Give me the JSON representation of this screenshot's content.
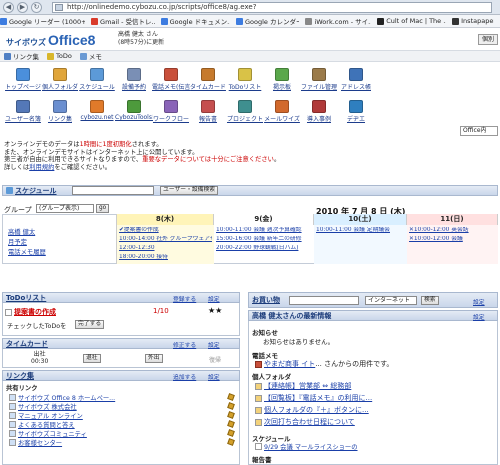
{
  "browser": {
    "url": "http://onlinedemo.cybozu.co.jp/scripts/office8/ag.exe?",
    "bookmarks": [
      {
        "label": "Google リーダー (1000+)",
        "color": "#3d7ce0"
      },
      {
        "label": "Gmail - 受信トレ...",
        "color": "#d93b2b"
      },
      {
        "label": "Google ドキュメン...",
        "color": "#3d7ce0"
      },
      {
        "label": "Google カレンダー",
        "color": "#3d7ce0"
      },
      {
        "label": "iWork.com - サイ...",
        "color": "#888888"
      },
      {
        "label": "Cult of Mac | The ...",
        "color": "#222222"
      },
      {
        "label": "Instapaper",
        "color": "#333333"
      }
    ]
  },
  "header": {
    "logo_prefix": "サイボウズ",
    "logo_main": "Office8",
    "user_name": "高橋 健太 さん",
    "user_status": "(8時57分)に更新",
    "right_button": "個別"
  },
  "linkbar": {
    "items": [
      {
        "label": "リンク集",
        "color": "#4f7fc4"
      },
      {
        "label": "ToDo",
        "color": "#d8b62a"
      },
      {
        "label": "メモ",
        "color": "#6a9ad4"
      }
    ]
  },
  "apps_row1": [
    {
      "label": "トップページ",
      "color": "#4b8fdc"
    },
    {
      "label": "個人フォルダ",
      "color": "#e0a53a"
    },
    {
      "label": "スケジュール",
      "color": "#5c9ad8"
    },
    {
      "label": "設備予約",
      "color": "#7a8fb5"
    },
    {
      "label": "電話メモ(伝言確認)",
      "color": "#c9503b"
    },
    {
      "label": "タイムカード",
      "color": "#c67a2d"
    },
    {
      "label": "ToDoリスト",
      "color": "#d9c247"
    },
    {
      "label": "掲示板",
      "color": "#5aa84b"
    },
    {
      "label": "ファイル管理",
      "color": "#9b7b4a"
    },
    {
      "label": "アドレス帳",
      "color": "#3f73b8"
    }
  ],
  "apps_row2": [
    {
      "label": "ユーザー名簿",
      "color": "#5478b8"
    },
    {
      "label": "リンク集",
      "color": "#6b8fd0"
    },
    {
      "label": "cybozu.net",
      "color": "#e07a2a"
    },
    {
      "label": "CybozuTools!",
      "color": "#4d9a3c"
    },
    {
      "label": "ワークフロー",
      "color": "#8a64b8"
    },
    {
      "label": "報告書",
      "color": "#c54f4f"
    },
    {
      "label": "プロジェクト",
      "color": "#3f8f8f"
    },
    {
      "label": "メールワイズ",
      "color": "#d2692c"
    },
    {
      "label": "導入事例",
      "color": "#b03a3a"
    },
    {
      "label": "デヂエ",
      "color": "#2f7fbf"
    }
  ],
  "display_select": "Office内",
  "notice": {
    "line1_a": "オンラインデモのデータは",
    "line1_red": "1時間に1度初期化",
    "line1_b": "されます。",
    "line2": "また、オンラインデモサイトはインターネット上に公開しています。",
    "line3_a": "第三者が自由に利用できるサイトなりますので、",
    "line3_red": "重要なデータについては十分にご注意ください",
    "line3_b": "。",
    "line4_a": "詳しくは",
    "line4_link": "利用規約",
    "line4_b": "をご確認ください。"
  },
  "schedule": {
    "title": "スケジュール",
    "search_button": "ユーザー・設備検索",
    "date": "2010 年 7 月 8 日 (木)",
    "group_label": "グループ",
    "group_select": "(グループ表示)",
    "go_button": "go",
    "columns": [
      "8(木)",
      "9(金)",
      "10(土)",
      "11(日)"
    ],
    "members": [
      "高橋 健太",
      "月予定",
      "電話メモ履歴"
    ],
    "events_day8": [
      {
        "text": "✔提案書の作成",
        "red": false
      },
      {
        "text": "10:00-14:00 社外 グループウェアセミナー",
        "red": false
      },
      {
        "text": "12:00-12:30",
        "red": false
      },
      {
        "text": "18:00-20:00 接待",
        "red": false
      }
    ],
    "events_day9": [
      {
        "text": "10:00-11:00 会議 週次予算確認",
        "red": false
      },
      {
        "text": "15:00-16:00 会議 新年二の研修",
        "red": false
      },
      {
        "text": "20:00-22:00 野球観戦(日ハム)",
        "red": false
      }
    ],
    "events_day10": [
      {
        "text": "10:00-11:00 会議 定期議会",
        "red": false
      }
    ],
    "events_day11": [
      {
        "text": "✕10:00-12:00 英会話",
        "red": false
      },
      {
        "text": "✕10:00-12:00 会議",
        "red": false
      }
    ]
  },
  "todo": {
    "title": "ToDoリスト",
    "register": "登録する",
    "settings": "設定",
    "item": "提案書の作成",
    "date": "1/10",
    "stars": "★★",
    "check_label": "チェックしたToDoを",
    "done_button": "完了する"
  },
  "timecard": {
    "title": "タイムカード",
    "edit": "修正する",
    "settings": "設定",
    "col_in": "出社",
    "col_out": "退社",
    "col_away": "外出",
    "col_back": "復帰",
    "time_in": "00:30"
  },
  "links": {
    "title": "リンク集",
    "add": "追加する",
    "settings": "設定",
    "group": "共有リンク",
    "items": [
      "サイボウズ Office 8 ホームペー...",
      "サイボウズ 株式会社",
      "マニュアル オンライン",
      "よくある質問と答え",
      "サイボウズコミュニティ",
      "お客様センター"
    ]
  },
  "shopping": {
    "title": "お買い物",
    "select": "インターネット",
    "search_button": "検索",
    "settings": "設定"
  },
  "latest": {
    "title": "高橋 健太さんの最新情報",
    "settings": "設定",
    "notice_head": "お知らせ",
    "notice_text": "お知らせはありません。",
    "phone_head": "電話メモ",
    "phone_item_link": "やまだ商事 イト",
    "phone_item_rest": "... さんからの用件です。",
    "folder_head": "個人フォルダ",
    "folder_items": [
      "【連絡帳】営業部 ⇔ 総務部",
      "【回覧板】『電話メモ』の利用に...",
      "個人フォルダの『＋』ボタンに...",
      "次回打ち合わせ日程について"
    ],
    "schedule_head": "スケジュール",
    "schedule_item": "9/29 会議 マールライスショーの",
    "report_head": "報告書"
  }
}
